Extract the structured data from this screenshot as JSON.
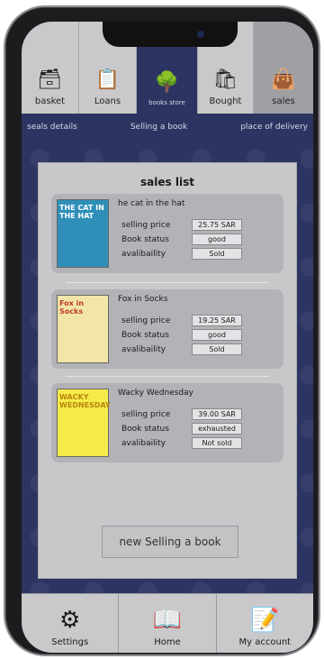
{
  "top_tabs": [
    {
      "id": "basket",
      "label": "basket",
      "icon": "basket-icon"
    },
    {
      "id": "loans",
      "label": "Loans",
      "icon": "loan-document-icon"
    },
    {
      "id": "store",
      "label": "books store",
      "icon": "book-tree-icon"
    },
    {
      "id": "bought",
      "label": "Bought",
      "icon": "buy-bag-icon"
    },
    {
      "id": "sales",
      "label": "sales",
      "icon": "sale-bag-icon"
    }
  ],
  "subnav": {
    "seals_details": "seals details",
    "selling_a_book": "Selling a book",
    "place_of_delivery": "place of delivery"
  },
  "sales_list": {
    "title": "sales list",
    "labels": {
      "price": "selling price",
      "status": "Book status",
      "availability": "avalibaility"
    },
    "items": [
      {
        "title": "he cat in the hat",
        "cover_text": "THE CAT IN THE HAT",
        "price": "25.75 SAR",
        "status": "good",
        "availability": "Sold"
      },
      {
        "title": "Fox in Socks",
        "cover_text": "Fox in Socks",
        "price": "19.25 SAR",
        "status": "good",
        "availability": "Sold"
      },
      {
        "title": "Wacky Wednesday",
        "cover_text": "WACKY WEDNESDAY",
        "price": "39.00 SAR",
        "status": "exhausted",
        "availability": "Not sold"
      }
    ],
    "new_button": "new Selling a book"
  },
  "bottom_nav": [
    {
      "id": "settings",
      "label": "Settings",
      "icon": "gears-icon"
    },
    {
      "id": "home",
      "label": "Home",
      "icon": "open-book-icon"
    },
    {
      "id": "account",
      "label": "My account",
      "icon": "profile-document-icon"
    }
  ],
  "colors": {
    "navy": "#2c3461",
    "panel": "#c8c8cb",
    "card": "#b3b3b7"
  }
}
